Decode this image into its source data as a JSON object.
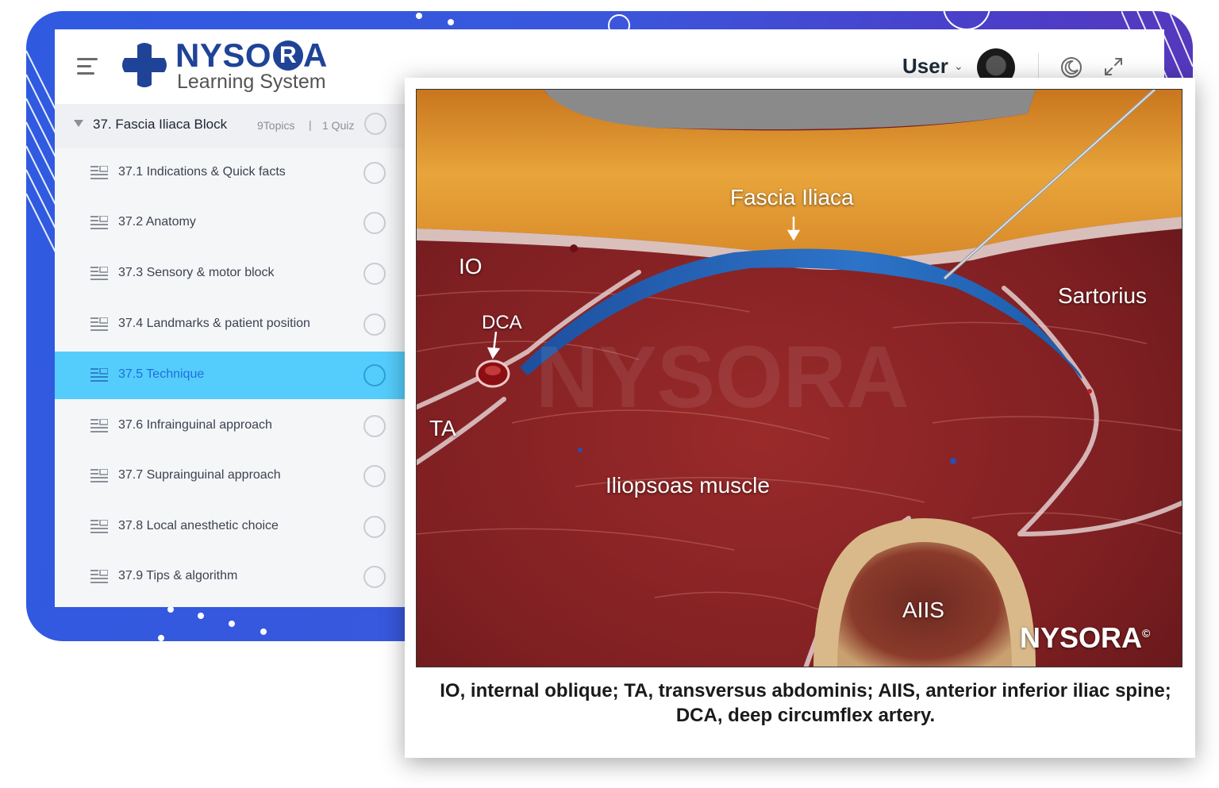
{
  "brand": {
    "name_prefix": "NYSO",
    "name_r": "R",
    "name_a": "A",
    "subtitle": "Learning System",
    "primary_color": "#1f4397"
  },
  "header": {
    "user_label": "User",
    "icons": [
      "menu-icon",
      "avatar",
      "moon-icon",
      "expand-icon"
    ]
  },
  "sidebar": {
    "section": {
      "title": "37. Fascia Iliaca Block",
      "topics": "9Topics",
      "separator": "|",
      "quiz": "1 Quiz"
    },
    "items": [
      {
        "label": "37.1 Indications & Quick facts",
        "active": false
      },
      {
        "label": "37.2 Anatomy",
        "active": false
      },
      {
        "label": "37.3 Sensory & motor block",
        "active": false
      },
      {
        "label": "37.4 Landmarks & patient position",
        "active": false
      },
      {
        "label": "37.5 Technique",
        "active": true
      },
      {
        "label": "37.6 Infrainguinal approach",
        "active": false
      },
      {
        "label": "37.7 Suprainguinal approach",
        "active": false
      },
      {
        "label": "37.8 Local anesthetic choice",
        "active": false
      },
      {
        "label": "37.9 Tips & algorithm",
        "active": false
      }
    ],
    "active_color": "#55cdfc"
  },
  "figure": {
    "labels": {
      "fascia": "Fascia Iliaca",
      "io": "IO",
      "dca": "DCA",
      "ta": "TA",
      "sartorius": "Sartorius",
      "iliopsoas": "Iliopsoas muscle",
      "aiis": "AIIS",
      "watermark": "NYSORA",
      "brand": "NYSORA",
      "copyright": "©"
    },
    "caption": "IO, internal oblique; TA, transversus abdominis; AIIS, anterior inferior iliac spine; DCA, deep circumflex artery."
  }
}
